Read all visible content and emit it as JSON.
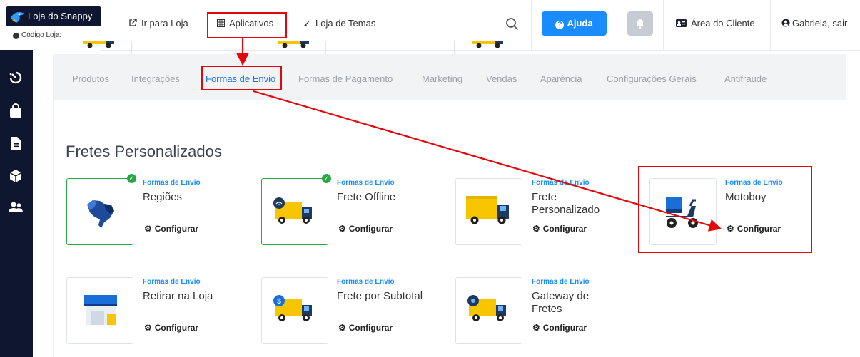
{
  "brand": {
    "name": "Loja do Snappy",
    "store_code": "Código Loja: "
  },
  "topnav": {
    "goto_store": "Ir para Loja",
    "apps": "Aplicativos",
    "theme_store": "Loja de Temas",
    "help": "Ajuda",
    "client_area": "Área do Cliente",
    "user": "Gabriela, sair"
  },
  "tabs": [
    "Produtos",
    "Integrações",
    "Formas de Envio",
    "Formas de Pagamento",
    "Marketing",
    "Vendas",
    "Aparência",
    "Configurações Gerais",
    "Antifraude"
  ],
  "active_tab": "Formas de Envio",
  "section": {
    "title": "Fretes Personalizados"
  },
  "cards": [
    {
      "category": "Formas de Envio",
      "name": "Regiões",
      "action": "Configurar",
      "enabled": true,
      "icon": "brazil-map-icon"
    },
    {
      "category": "Formas de Envio",
      "name": "Frete Offline",
      "action": "Configurar",
      "enabled": true,
      "icon": "truck-wifi-icon"
    },
    {
      "category": "Formas de Envio",
      "name": "Frete Personalizado",
      "action": "Configurar",
      "enabled": false,
      "icon": "truck-icon"
    },
    {
      "category": "Formas de Envio",
      "name": "Motoboy",
      "action": "Configurar",
      "enabled": false,
      "icon": "scooter-icon"
    },
    {
      "category": "Formas de Envio",
      "name": "Retirar na Loja",
      "action": "Configurar",
      "enabled": false,
      "icon": "storefront-icon"
    },
    {
      "category": "Formas de Envio",
      "name": "Frete por Subtotal",
      "action": "Configurar",
      "enabled": false,
      "icon": "truck-dollar-icon"
    },
    {
      "category": "Formas de Envio",
      "name": "Gateway de Fretes",
      "action": "Configurar",
      "enabled": false,
      "icon": "truck-gear-icon"
    }
  ],
  "colors": {
    "sidebar": "#0f1630",
    "accent": "#1a8cff",
    "enabled": "#28a745",
    "annotation": "#e2070b",
    "truck": "#f7c600"
  }
}
